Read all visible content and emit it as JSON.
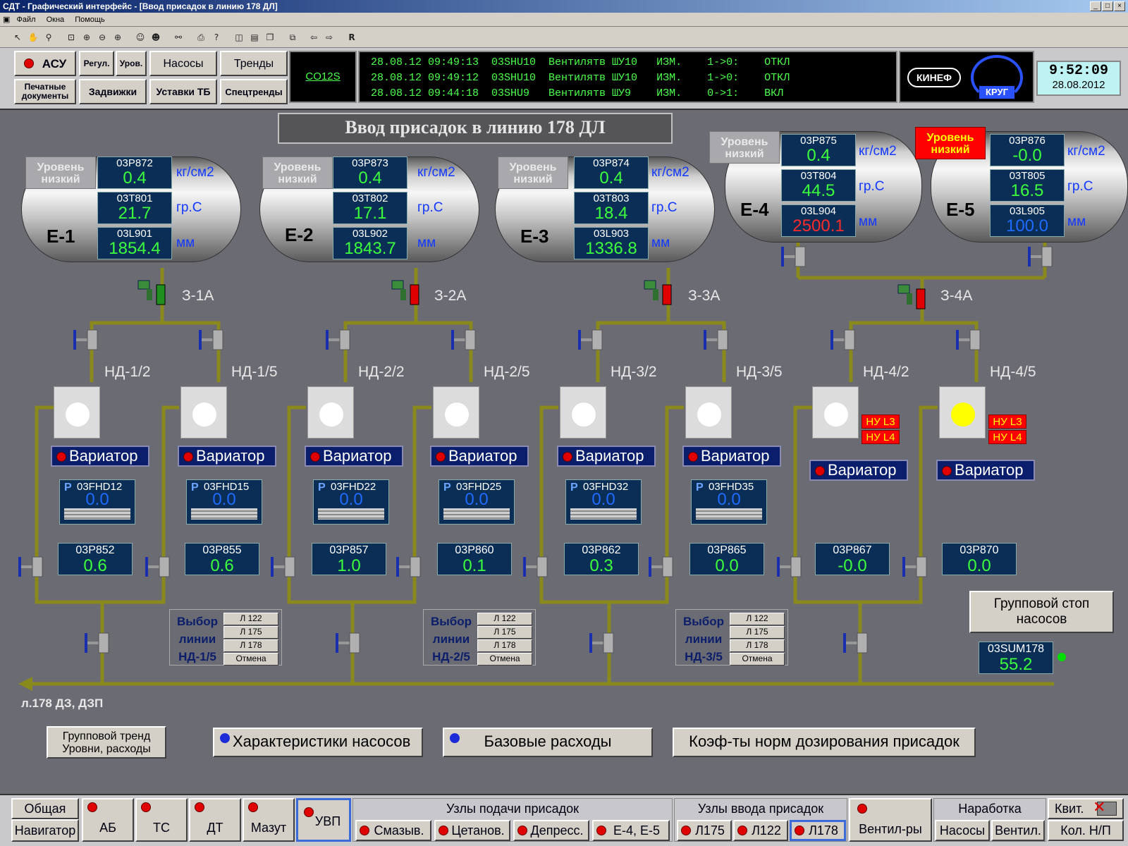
{
  "window": {
    "title": "СДТ - Графический интерфейс - [Ввод присадок в линию 178 ДЛ]"
  },
  "menu": [
    "Файл",
    "Окна",
    "Помощь"
  ],
  "toolbar": {
    "r_label": "R"
  },
  "topnav": {
    "asu": "АСУ",
    "regul": "Регул.",
    "urov": "Уров.",
    "nasosy": "Насосы",
    "trendy": "Тренды",
    "pechat": "Печатные документы",
    "zadvizhki": "Задвижки",
    "ustavki": "Уставки ТБ",
    "spectrendy": "Спецтренды"
  },
  "co12s": "CO12S",
  "messages": [
    "28.08.12 09:49:13  03SHU10  Вентилятв ШУ10   ИЗМ.    1->0:    ОТКЛ",
    "28.08.12 09:49:12  03SHU10  Вентилятв ШУ10   ИЗМ.    1->0:    ОТКЛ",
    "28.08.12 09:44:18  03SHU9   Вентилятв ШУ9    ИЗМ.    0->1:    ВКЛ"
  ],
  "logos": {
    "kinef": "КИНЕФ",
    "krug": "КРУГ"
  },
  "clock": {
    "time": "9:52:09",
    "date": "28.08.2012"
  },
  "page_title": "Ввод присадок в линию 178 ДЛ",
  "units": {
    "pressure": "кг/см2",
    "temp": "гр.С",
    "level": "мм"
  },
  "tanks": [
    {
      "name": "Е-1",
      "low": "Уровень низкий",
      "low_alarm": false,
      "p_tag": "03P872",
      "p_val": "0.4",
      "t_tag": "03T801",
      "t_val": "21.7",
      "l_tag": "03L901",
      "l_val": "1854.4",
      "l_color": "green"
    },
    {
      "name": "Е-2",
      "low": "Уровень низкий",
      "low_alarm": false,
      "p_tag": "03P873",
      "p_val": "0.4",
      "t_tag": "03T802",
      "t_val": "17.1",
      "l_tag": "03L902",
      "l_val": "1843.7",
      "l_color": "green"
    },
    {
      "name": "Е-3",
      "low": "Уровень низкий",
      "low_alarm": false,
      "p_tag": "03P874",
      "p_val": "0.4",
      "t_tag": "03T803",
      "t_val": "18.4",
      "l_tag": "03L903",
      "l_val": "1336.8",
      "l_color": "green"
    },
    {
      "name": "Е-4",
      "low": "Уровень низкий",
      "low_alarm": false,
      "p_tag": "03P875",
      "p_val": "0.4",
      "t_tag": "03T804",
      "t_val": "44.5",
      "l_tag": "03L904",
      "l_val": "2500.1",
      "l_color": "red"
    },
    {
      "name": "Е-5",
      "low": "Уровень низкий",
      "low_alarm": true,
      "p_tag": "03P876",
      "p_val": "-0.0",
      "t_tag": "03T805",
      "t_val": "16.5",
      "l_tag": "03L905",
      "l_val": "100.0",
      "l_color": "blue"
    }
  ],
  "valves": [
    "З-1А",
    "З-2А",
    "З-3А",
    "З-4А"
  ],
  "pumps": [
    {
      "name": "НД-1/2",
      "flow_tag": "03FHD12",
      "flow_val": "0.0",
      "p_tag": "03P852",
      "p_val": "0.6",
      "variator": "Вариатор",
      "dot": "white"
    },
    {
      "name": "НД-1/5",
      "flow_tag": "03FHD15",
      "flow_val": "0.0",
      "p_tag": "03P855",
      "p_val": "0.6",
      "variator": "Вариатор",
      "dot": "white"
    },
    {
      "name": "НД-2/2",
      "flow_tag": "03FHD22",
      "flow_val": "0.0",
      "p_tag": "03P857",
      "p_val": "1.0",
      "variator": "Вариатор",
      "dot": "white"
    },
    {
      "name": "НД-2/5",
      "flow_tag": "03FHD25",
      "flow_val": "0.0",
      "p_tag": "03P860",
      "p_val": "0.1",
      "variator": "Вариатор",
      "dot": "white"
    },
    {
      "name": "НД-3/2",
      "flow_tag": "03FHD32",
      "flow_val": "0.0",
      "p_tag": "03P862",
      "p_val": "0.3",
      "variator": "Вариатор",
      "dot": "white"
    },
    {
      "name": "НД-3/5",
      "flow_tag": "03FHD35",
      "flow_val": "0.0",
      "p_tag": "03P865",
      "p_val": "0.0",
      "variator": "Вариатор",
      "dot": "white"
    },
    {
      "name": "НД-4/2",
      "p_tag": "03P867",
      "p_val": "-0.0",
      "variator": "Вариатор",
      "dot": "white",
      "nu": [
        "НУ L3",
        "НУ L4"
      ]
    },
    {
      "name": "НД-4/5",
      "p_tag": "03P870",
      "p_val": "0.0",
      "variator": "Вариатор",
      "dot": "yellow",
      "nu": [
        "НУ L3",
        "НУ L4"
      ]
    }
  ],
  "line_select": [
    {
      "title1": "Выбор",
      "title2": "линии",
      "title3": "НД-1/5",
      "opts": [
        "Л 122",
        "Л 175",
        "Л 178",
        "Отмена"
      ]
    },
    {
      "title1": "Выбор",
      "title2": "линии",
      "title3": "НД-2/5",
      "opts": [
        "Л 122",
        "Л 175",
        "Л 178",
        "Отмена"
      ]
    },
    {
      "title1": "Выбор",
      "title2": "линии",
      "title3": "НД-3/5",
      "opts": [
        "Л 122",
        "Л 175",
        "Л 178",
        "Отмена"
      ]
    }
  ],
  "group_stop": "Групповой стоп насосов",
  "sum": {
    "tag": "03SUM178",
    "val": "55.2"
  },
  "line_out": "л.178 ДЗ, ДЗП",
  "buttons": {
    "group_trend": "Групповой тренд Уровни, расходы",
    "pump_char": "Характеристики насосов",
    "base_flow": "Базовые расходы",
    "coef": "Коэф-ты норм дозирования присадок"
  },
  "bottom": {
    "obshaya": "Общая",
    "navigator": "Навигатор",
    "ab": "АБ",
    "ts": "ТС",
    "dt": "ДТ",
    "mazut": "Мазут",
    "uvp": "УВП",
    "uzly_podachi": "Узлы подачи присадок",
    "smazyv": "Смазыв.",
    "cetanov": "Цетанов.",
    "depress": "Депресс.",
    "e45": "Е-4, Е-5",
    "uzly_vvoda": "Узлы ввода присадок",
    "l175": "Л175",
    "l122": "Л122",
    "l178": "Л178",
    "ventil": "Вентил-ры",
    "narabotka": "Наработка",
    "nasosy": "Насосы",
    "ventil2": "Вентил.",
    "kvit": "Квит.",
    "kol": "Кол. Н/П"
  },
  "colors": {
    "pipe": "#8a8a1c",
    "panel_bg": "#0b2e57",
    "value_green": "#3cff3c",
    "alarm_red": "#ff0000",
    "valve_blue": "#1a2fb0"
  }
}
